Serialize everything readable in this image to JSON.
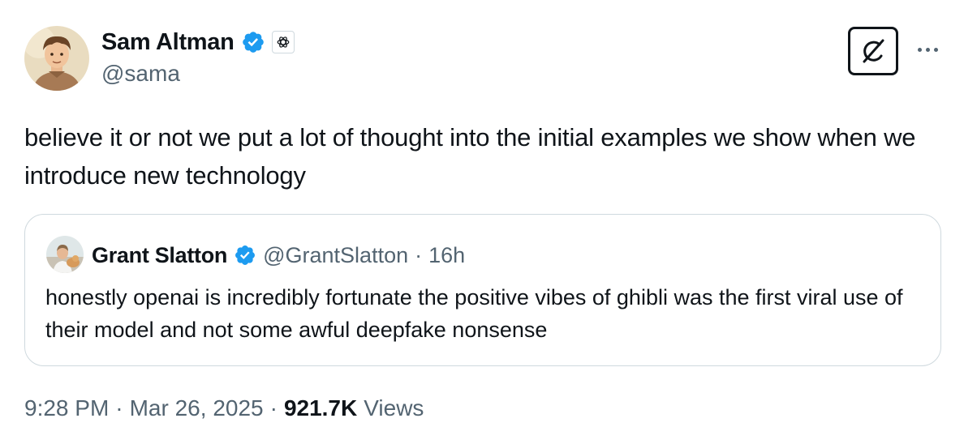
{
  "tweet": {
    "author_name": "Sam Altman",
    "author_handle": "@sama",
    "text": "believe it or not we put a lot of thought into the initial examples we show when we introduce new technology",
    "time": "9:28 PM",
    "date": "Mar 26, 2025",
    "views_count": "921.7K",
    "views_label": "Views",
    "separator": "·"
  },
  "quoted": {
    "author_name": "Grant Slatton",
    "author_handle": "@GrantSlatton",
    "separator": "·",
    "age": "16h",
    "text": "honestly openai is incredibly fortunate the positive vibes of ghibli was the first viral use of their model and not some awful deepfake nonsense"
  },
  "icons": {
    "verified": "verified-badge-icon",
    "affiliate": "openai-logo-icon",
    "grok": "grok-icon",
    "more": "more-options-icon"
  },
  "colors": {
    "verified_blue": "#1d9bf0",
    "secondary_text": "#536471",
    "primary_text": "#0f1419",
    "border": "#cfd9de"
  }
}
